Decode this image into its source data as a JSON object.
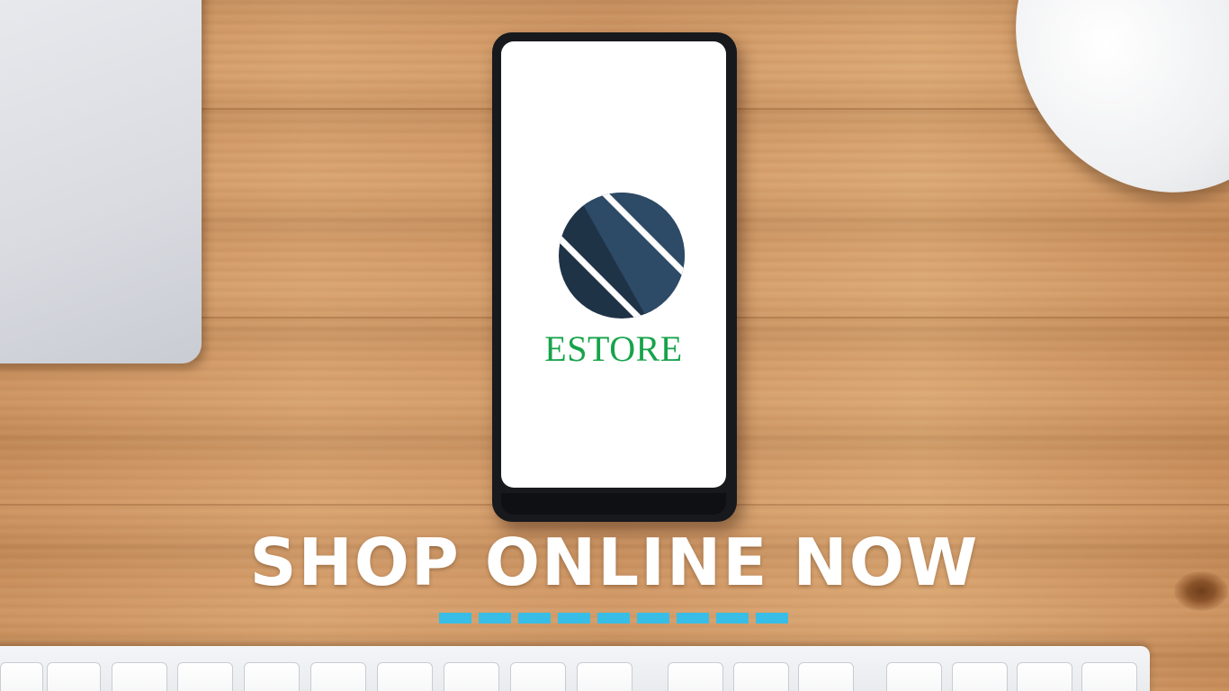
{
  "brand": {
    "name": "ESTORE",
    "logo_icon": "striped-circle-logo",
    "logo_colors": [
      "#1f3347",
      "#2d4a66"
    ],
    "name_color": "#16a34a"
  },
  "headline": {
    "text": "SHOP ONLINE NOW",
    "color": "#ffffff"
  },
  "accent": {
    "dash_color": "#38bde6",
    "dash_count": 9
  },
  "objects": [
    "laptop-icon",
    "smartphone-icon",
    "mouse-icon",
    "keyboard-icon"
  ]
}
